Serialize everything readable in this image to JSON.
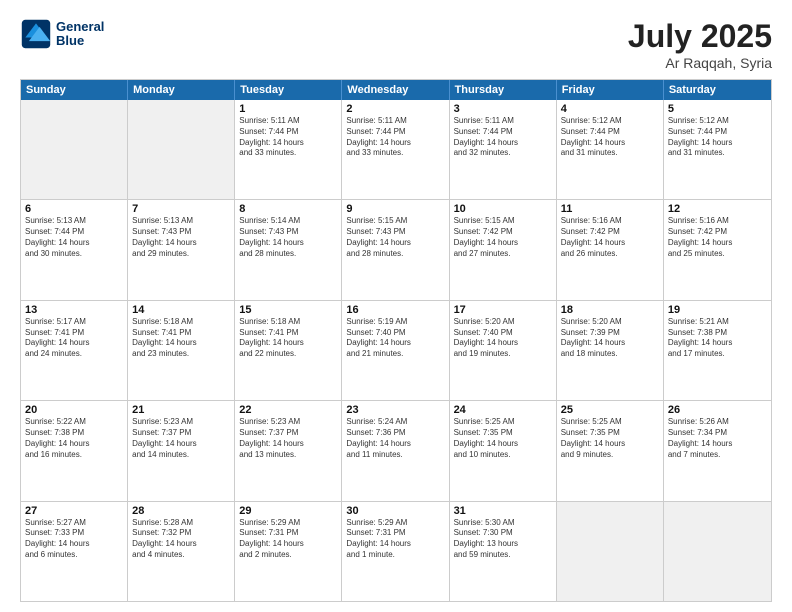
{
  "logo": {
    "line1": "General",
    "line2": "Blue"
  },
  "title": "July 2025",
  "location": "Ar Raqqah, Syria",
  "header_days": [
    "Sunday",
    "Monday",
    "Tuesday",
    "Wednesday",
    "Thursday",
    "Friday",
    "Saturday"
  ],
  "weeks": [
    [
      {
        "day": "",
        "info": "",
        "shaded": true
      },
      {
        "day": "",
        "info": "",
        "shaded": true
      },
      {
        "day": "1",
        "info": "Sunrise: 5:11 AM\nSunset: 7:44 PM\nDaylight: 14 hours\nand 33 minutes.",
        "shaded": false
      },
      {
        "day": "2",
        "info": "Sunrise: 5:11 AM\nSunset: 7:44 PM\nDaylight: 14 hours\nand 33 minutes.",
        "shaded": false
      },
      {
        "day": "3",
        "info": "Sunrise: 5:11 AM\nSunset: 7:44 PM\nDaylight: 14 hours\nand 32 minutes.",
        "shaded": false
      },
      {
        "day": "4",
        "info": "Sunrise: 5:12 AM\nSunset: 7:44 PM\nDaylight: 14 hours\nand 31 minutes.",
        "shaded": false
      },
      {
        "day": "5",
        "info": "Sunrise: 5:12 AM\nSunset: 7:44 PM\nDaylight: 14 hours\nand 31 minutes.",
        "shaded": false
      }
    ],
    [
      {
        "day": "6",
        "info": "Sunrise: 5:13 AM\nSunset: 7:44 PM\nDaylight: 14 hours\nand 30 minutes.",
        "shaded": false
      },
      {
        "day": "7",
        "info": "Sunrise: 5:13 AM\nSunset: 7:43 PM\nDaylight: 14 hours\nand 29 minutes.",
        "shaded": false
      },
      {
        "day": "8",
        "info": "Sunrise: 5:14 AM\nSunset: 7:43 PM\nDaylight: 14 hours\nand 28 minutes.",
        "shaded": false
      },
      {
        "day": "9",
        "info": "Sunrise: 5:15 AM\nSunset: 7:43 PM\nDaylight: 14 hours\nand 28 minutes.",
        "shaded": false
      },
      {
        "day": "10",
        "info": "Sunrise: 5:15 AM\nSunset: 7:42 PM\nDaylight: 14 hours\nand 27 minutes.",
        "shaded": false
      },
      {
        "day": "11",
        "info": "Sunrise: 5:16 AM\nSunset: 7:42 PM\nDaylight: 14 hours\nand 26 minutes.",
        "shaded": false
      },
      {
        "day": "12",
        "info": "Sunrise: 5:16 AM\nSunset: 7:42 PM\nDaylight: 14 hours\nand 25 minutes.",
        "shaded": false
      }
    ],
    [
      {
        "day": "13",
        "info": "Sunrise: 5:17 AM\nSunset: 7:41 PM\nDaylight: 14 hours\nand 24 minutes.",
        "shaded": false
      },
      {
        "day": "14",
        "info": "Sunrise: 5:18 AM\nSunset: 7:41 PM\nDaylight: 14 hours\nand 23 minutes.",
        "shaded": false
      },
      {
        "day": "15",
        "info": "Sunrise: 5:18 AM\nSunset: 7:41 PM\nDaylight: 14 hours\nand 22 minutes.",
        "shaded": false
      },
      {
        "day": "16",
        "info": "Sunrise: 5:19 AM\nSunset: 7:40 PM\nDaylight: 14 hours\nand 21 minutes.",
        "shaded": false
      },
      {
        "day": "17",
        "info": "Sunrise: 5:20 AM\nSunset: 7:40 PM\nDaylight: 14 hours\nand 19 minutes.",
        "shaded": false
      },
      {
        "day": "18",
        "info": "Sunrise: 5:20 AM\nSunset: 7:39 PM\nDaylight: 14 hours\nand 18 minutes.",
        "shaded": false
      },
      {
        "day": "19",
        "info": "Sunrise: 5:21 AM\nSunset: 7:38 PM\nDaylight: 14 hours\nand 17 minutes.",
        "shaded": false
      }
    ],
    [
      {
        "day": "20",
        "info": "Sunrise: 5:22 AM\nSunset: 7:38 PM\nDaylight: 14 hours\nand 16 minutes.",
        "shaded": false
      },
      {
        "day": "21",
        "info": "Sunrise: 5:23 AM\nSunset: 7:37 PM\nDaylight: 14 hours\nand 14 minutes.",
        "shaded": false
      },
      {
        "day": "22",
        "info": "Sunrise: 5:23 AM\nSunset: 7:37 PM\nDaylight: 14 hours\nand 13 minutes.",
        "shaded": false
      },
      {
        "day": "23",
        "info": "Sunrise: 5:24 AM\nSunset: 7:36 PM\nDaylight: 14 hours\nand 11 minutes.",
        "shaded": false
      },
      {
        "day": "24",
        "info": "Sunrise: 5:25 AM\nSunset: 7:35 PM\nDaylight: 14 hours\nand 10 minutes.",
        "shaded": false
      },
      {
        "day": "25",
        "info": "Sunrise: 5:25 AM\nSunset: 7:35 PM\nDaylight: 14 hours\nand 9 minutes.",
        "shaded": false
      },
      {
        "day": "26",
        "info": "Sunrise: 5:26 AM\nSunset: 7:34 PM\nDaylight: 14 hours\nand 7 minutes.",
        "shaded": false
      }
    ],
    [
      {
        "day": "27",
        "info": "Sunrise: 5:27 AM\nSunset: 7:33 PM\nDaylight: 14 hours\nand 6 minutes.",
        "shaded": false
      },
      {
        "day": "28",
        "info": "Sunrise: 5:28 AM\nSunset: 7:32 PM\nDaylight: 14 hours\nand 4 minutes.",
        "shaded": false
      },
      {
        "day": "29",
        "info": "Sunrise: 5:29 AM\nSunset: 7:31 PM\nDaylight: 14 hours\nand 2 minutes.",
        "shaded": false
      },
      {
        "day": "30",
        "info": "Sunrise: 5:29 AM\nSunset: 7:31 PM\nDaylight: 14 hours\nand 1 minute.",
        "shaded": false
      },
      {
        "day": "31",
        "info": "Sunrise: 5:30 AM\nSunset: 7:30 PM\nDaylight: 13 hours\nand 59 minutes.",
        "shaded": false
      },
      {
        "day": "",
        "info": "",
        "shaded": true
      },
      {
        "day": "",
        "info": "",
        "shaded": true
      }
    ]
  ]
}
